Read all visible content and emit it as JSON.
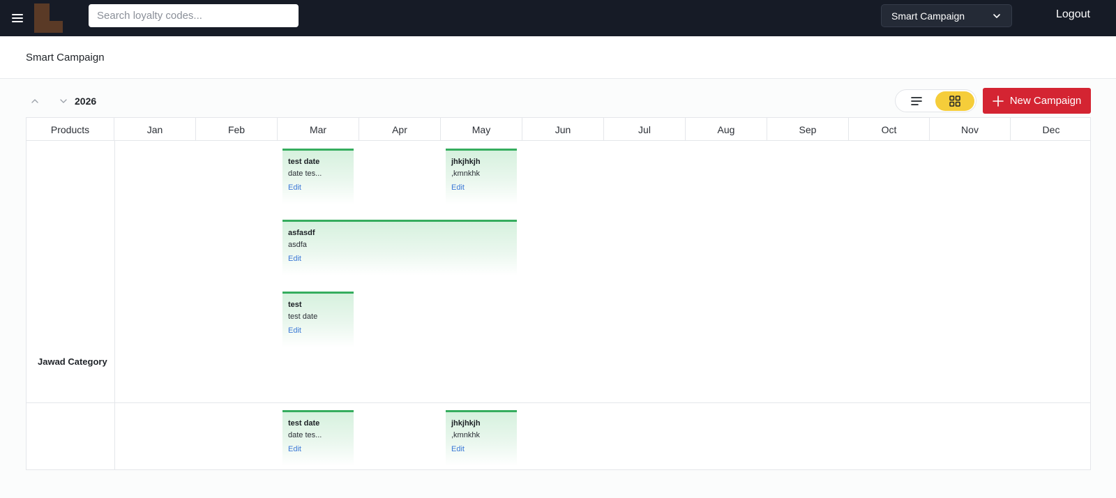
{
  "topbar": {
    "search_placeholder": "Search loyalty codes...",
    "module_selected": "Smart Campaign",
    "logout_label": "Logout",
    "colors": {
      "background": "#161b26",
      "logo": "#5a3a26"
    }
  },
  "page": {
    "title": "Smart Campaign"
  },
  "toolbar": {
    "year": "2026",
    "new_campaign_label": "New Campaign",
    "colors": {
      "new_campaign": "#d42432",
      "active_view": "#f5cd3a"
    }
  },
  "calendar": {
    "header": {
      "products": "Products",
      "months": [
        "Jan",
        "Feb",
        "Mar",
        "Apr",
        "May",
        "Jun",
        "Jul",
        "Aug",
        "Sep",
        "Oct",
        "Nov",
        "Dec"
      ]
    },
    "rows": [
      {
        "label": "Jawad Category",
        "campaigns": [
          {
            "title": "test date",
            "description": "date tes...",
            "edit_label": "Edit"
          },
          {
            "title": "jhkjhkjh",
            "description": ",kmnkhk",
            "edit_label": "Edit"
          },
          {
            "title": "asfasdf",
            "description": "asdfa",
            "edit_label": "Edit"
          },
          {
            "title": "test",
            "description": "test date",
            "edit_label": "Edit"
          }
        ]
      },
      {
        "label": "",
        "campaigns": [
          {
            "title": "test date",
            "description": "date tes...",
            "edit_label": "Edit"
          },
          {
            "title": "jhkjhkjh",
            "description": ",kmnkhk",
            "edit_label": "Edit"
          }
        ]
      }
    ],
    "colors": {
      "card_accent": "#35ad5e",
      "edit_link": "#3a78d6"
    }
  }
}
